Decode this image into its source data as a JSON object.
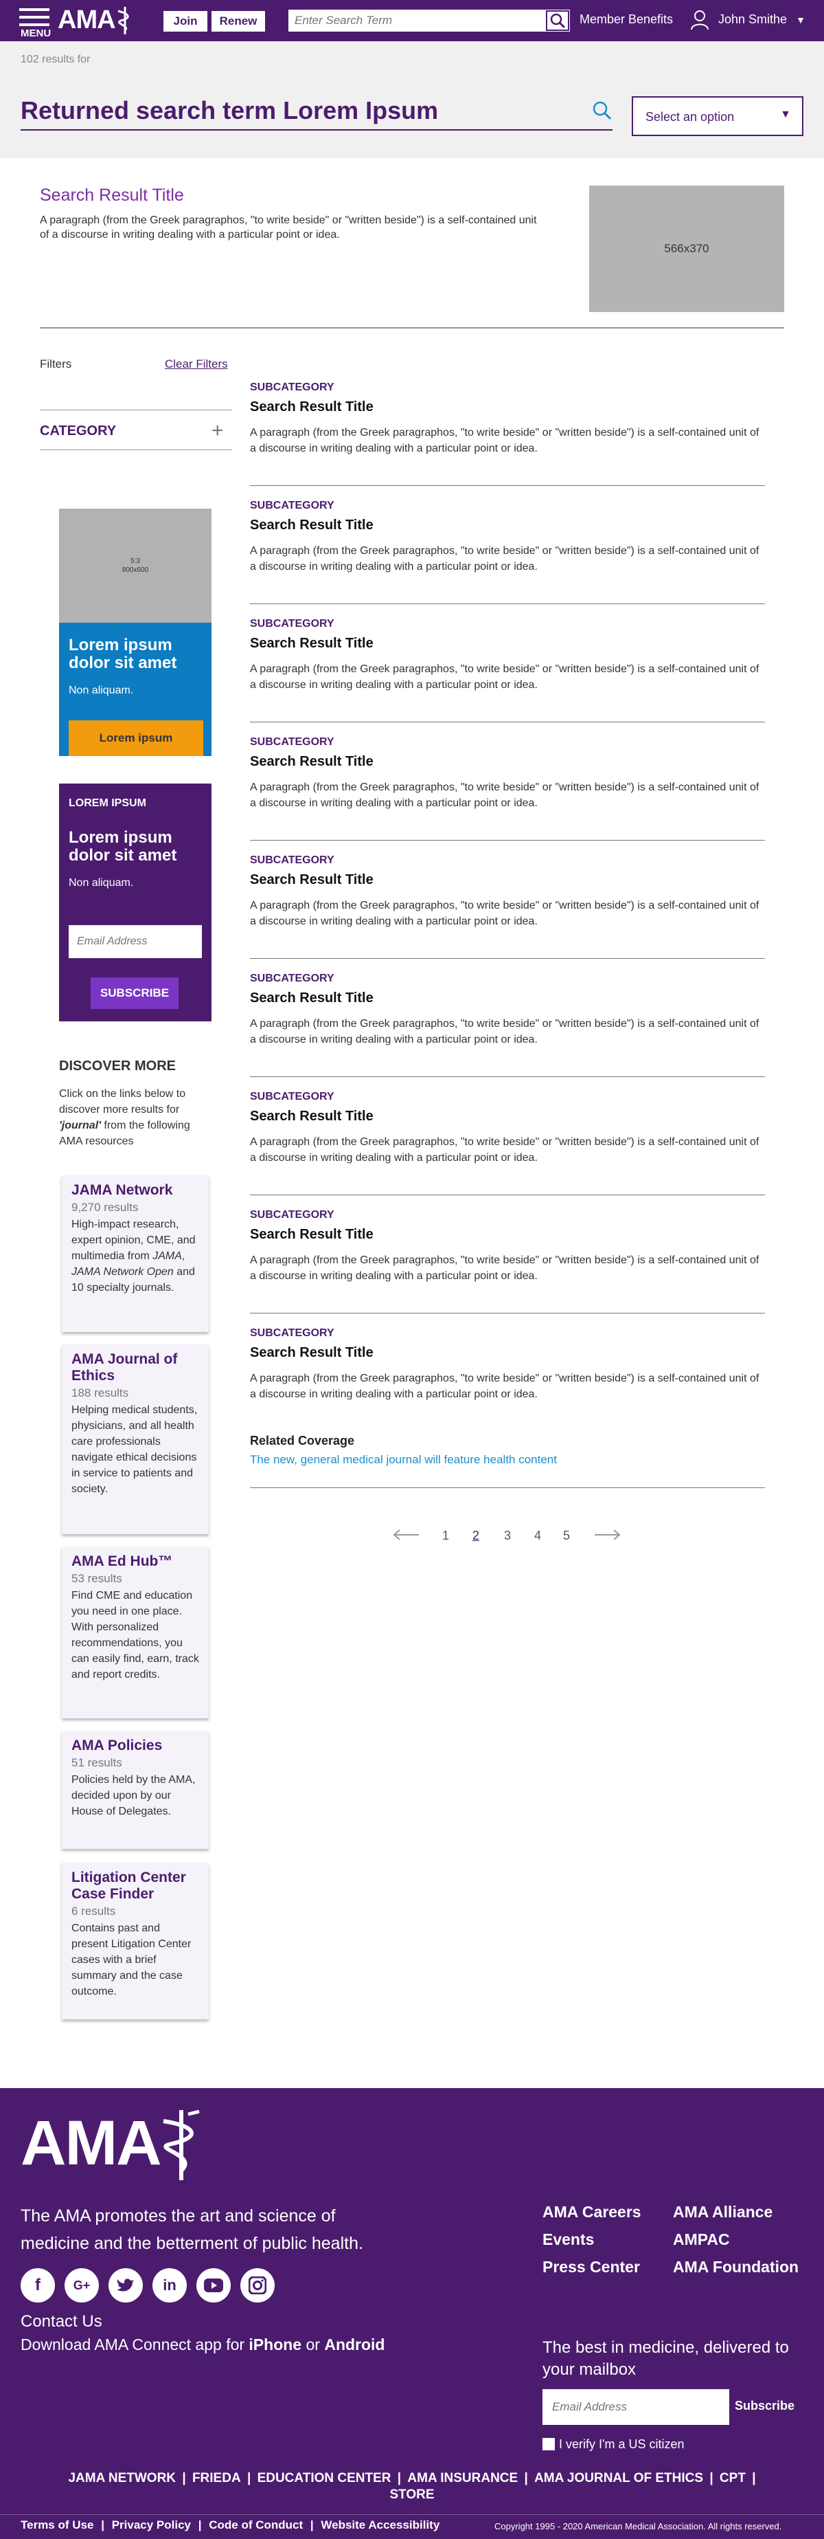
{
  "header": {
    "menu_label": "MENU",
    "logo_text": "AMA",
    "join_label": "Join",
    "renew_label": "Renew",
    "search_placeholder": "Enter Search Term",
    "member_benefits": "Member Benefits",
    "user_name": "John Smithe"
  },
  "search": {
    "results_count": "102 results for",
    "term": "Returned search term Lorem Ipsum",
    "select_placeholder": "Select an option"
  },
  "feature": {
    "title": "Search Result Title",
    "text": "A paragraph (from the Greek paragraphos, \"to write beside\" or \"written beside\") is a self-contained unit of a discourse in writing dealing with a particular point or idea.",
    "image_label": "566x370"
  },
  "filters": {
    "label": "Filters",
    "clear_label": "Clear Filters",
    "category_label": "CATEGORY"
  },
  "promo1": {
    "image_label": "5:3",
    "image_size": "800x600",
    "title": "Lorem ipsum dolor sit amet",
    "subtitle": "Non aliquam.",
    "button_label": "Lorem ipsum"
  },
  "promo2": {
    "kicker": "LOREM IPSUM",
    "title": "Lorem ipsum dolor sit amet",
    "subtitle": "Non aliquam.",
    "email_placeholder": "Email Address",
    "button_label": "SUBSCRIBE"
  },
  "discover": {
    "title": "DISCOVER MORE",
    "text_before": "Click on the links below to discover more results for ",
    "term": "'journal'",
    "text_after": " from the following AMA resources",
    "cards": [
      {
        "title": "JAMA Network",
        "count": "9,270 results",
        "desc": "High-impact research, expert opinion, CME, and multimedia from JAMA, JAMA Network Open and 10 specialty journals."
      },
      {
        "title": "AMA Journal of Ethics",
        "count": "188 results",
        "desc": "Helping medical students, physicians, and all health care professionals navigate ethical decisions in service to patients and society."
      },
      {
        "title": "AMA Ed Hub™",
        "count": "53 results",
        "desc": "Find CME and education you need in one place. With personalized recommendations, you can easily find, earn, track and report credits."
      },
      {
        "title": "AMA Policies",
        "count": "51 results",
        "desc": "Policies held by the AMA, decided upon by our House of Delegates."
      },
      {
        "title": "Litigation Center Case Finder",
        "count": "6 results",
        "desc": "Contains past and present Litigation Center cases with a brief summary and the case outcome."
      }
    ]
  },
  "results": [
    {
      "subcategory": "SUBCATEGORY",
      "title": "Search Result Title",
      "text": "A paragraph (from the Greek paragraphos, \"to write beside\" or \"written beside\") is a self-contained unit of a discourse in writing dealing with a particular point or idea."
    },
    {
      "subcategory": "SUBCATEGORY",
      "title": "Search Result Title",
      "text": "A paragraph (from the Greek paragraphos, \"to write beside\" or \"written beside\") is a self-contained unit of a discourse in writing dealing with a particular point or idea."
    },
    {
      "subcategory": "SUBCATEGORY",
      "title": "Search Result Title",
      "text": "A paragraph (from the Greek paragraphos, \"to write beside\" or \"written beside\") is a self-contained unit of a discourse in writing dealing with a particular point or idea."
    },
    {
      "subcategory": "SUBCATEGORY",
      "title": "Search Result Title",
      "text": "A paragraph (from the Greek paragraphos, \"to write beside\" or \"written beside\") is a self-contained unit of a discourse in writing dealing with a particular point or idea."
    },
    {
      "subcategory": "SUBCATEGORY",
      "title": "Search Result Title",
      "text": "A paragraph (from the Greek paragraphos, \"to write beside\" or \"written beside\") is a self-contained unit of a discourse in writing dealing with a particular point or idea."
    },
    {
      "subcategory": "SUBCATEGORY",
      "title": "Search Result Title",
      "text": "A paragraph (from the Greek paragraphos, \"to write beside\" or \"written beside\") is a self-contained unit of a discourse in writing dealing with a particular point or idea."
    },
    {
      "subcategory": "SUBCATEGORY",
      "title": "Search Result Title",
      "text": "A paragraph (from the Greek paragraphos, \"to write beside\" or \"written beside\") is a self-contained unit of a discourse in writing dealing with a particular point or idea."
    },
    {
      "subcategory": "SUBCATEGORY",
      "title": "Search Result Title",
      "text": "A paragraph (from the Greek paragraphos, \"to write beside\" or \"written beside\") is a self-contained unit of a discourse in writing dealing with a particular point or idea."
    },
    {
      "subcategory": "SUBCATEGORY",
      "title": "Search Result Title",
      "text": "A paragraph (from the Greek paragraphos, \"to write beside\" or \"written beside\") is a self-contained unit of a discourse in writing dealing with a particular point or idea."
    }
  ],
  "related": {
    "title": "Related Coverage",
    "link": "The new, general medical journal will feature health content"
  },
  "pagination": {
    "pages": [
      "1",
      "2",
      "3",
      "4",
      "5"
    ],
    "current": "2",
    "prev_icon": "arrow-left-icon",
    "next_icon": "arrow-right-icon"
  },
  "footer": {
    "logo_text": "AMA",
    "tagline": "The AMA promotes the art and science of medicine and the betterment of public health.",
    "contact": "Contact Us",
    "download_prefix": "Download AMA Connect app for ",
    "iphone": "iPhone",
    "or": " or ",
    "android": "Android",
    "col1": [
      "AMA Careers",
      "Events",
      "Press Center"
    ],
    "col2": [
      "AMA Alliance",
      "AMPAC",
      "AMA Foundation"
    ],
    "best": "The best in medicine, delivered to your mailbox",
    "email_placeholder": "Email Address",
    "subscribe": "Subscribe",
    "verify": "I verify I'm a US citizen",
    "links": [
      "JAMA NETWORK",
      "FRIEDA",
      "EDUCATION CENTER",
      "AMA INSURANCE",
      "AMA JOURNAL OF ETHICS",
      "CPT",
      "STORE"
    ],
    "legal": [
      "Terms of Use",
      "Privacy Policy",
      "Code of Conduct",
      "Website Accessibility"
    ],
    "copyright": "Copyright 1995 - 2020 American Medical Association. All rights reserved.",
    "social": [
      "facebook-icon",
      "google-plus-icon",
      "twitter-icon",
      "linkedin-icon",
      "youtube-icon",
      "instagram-icon"
    ]
  },
  "colors": {
    "brand": "#4b1c6d",
    "accent_blue": "#0d7cc0",
    "accent_orange": "#f29b0f",
    "link": "#1a8fc9"
  }
}
